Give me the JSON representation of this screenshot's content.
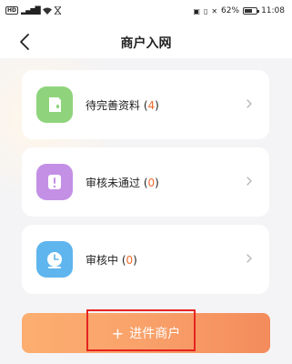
{
  "status_bar": {
    "left_badge": "HD",
    "signal_text": "4G",
    "battery_text": "62%",
    "battery_level": 0.62,
    "time": "11:08"
  },
  "nav": {
    "back_icon": "chevron-left-icon",
    "title": "商户入网"
  },
  "cards": [
    {
      "label": "待完善资料",
      "count": "4",
      "icon": "document-icon",
      "color": "#8fd47c"
    },
    {
      "label": "审核未通过",
      "count": "0",
      "icon": "exclamation-icon",
      "color": "#c490e6"
    },
    {
      "label": "审核中",
      "count": "0",
      "icon": "clock-icon",
      "color": "#5fb5ee"
    }
  ],
  "cta": {
    "label": "进件商户",
    "plus": "+"
  },
  "colors": {
    "accent": "#f48b5c",
    "count": "#f06a2b",
    "highlight": "#e52420"
  }
}
